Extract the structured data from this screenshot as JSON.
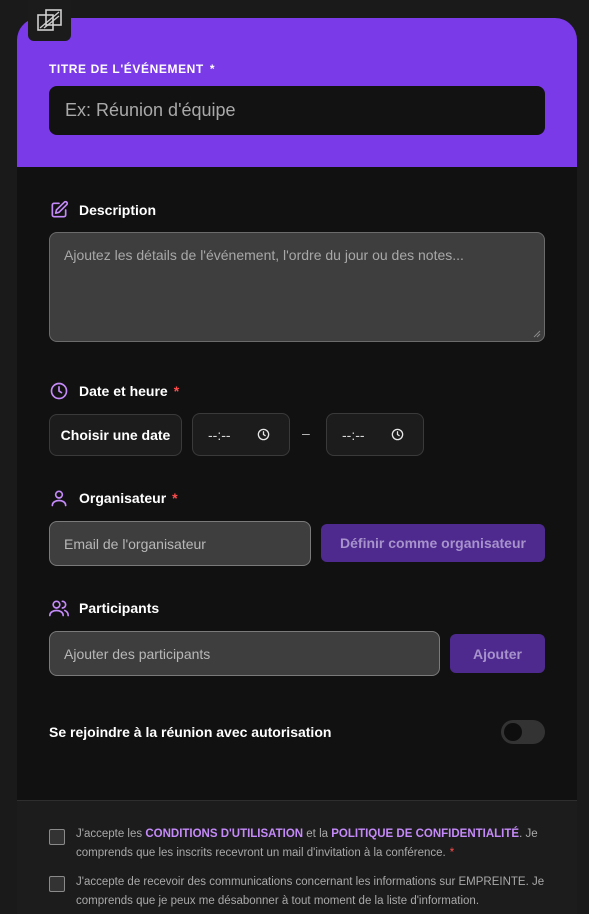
{
  "logo": {
    "icon": "squares-logo-icon"
  },
  "header": {
    "title_label": "TITRE DE L'ÉVÉNEMENT",
    "title_required": "*",
    "title_placeholder": "Ex: Réunion d'équipe",
    "color": "#7a3ae8"
  },
  "description": {
    "label": "Description",
    "icon": "edit-icon",
    "placeholder": "Ajoutez les détails de l'événement, l'ordre du jour ou des notes..."
  },
  "datetime": {
    "label": "Date et heure",
    "required": "*",
    "icon": "clock-icon",
    "date_button": "Choisir une date",
    "start_time": "--:--",
    "end_time": "--:--",
    "separator": "–"
  },
  "organizer": {
    "label": "Organisateur",
    "required": "*",
    "icon": "user-icon",
    "placeholder": "Email de l'organisateur",
    "button": "Définir comme organisateur"
  },
  "participants": {
    "label": "Participants",
    "icon": "users-icon",
    "placeholder": "Ajouter des participants",
    "button": "Ajouter"
  },
  "authorization": {
    "label": "Se rejoindre à la réunion avec autorisation",
    "enabled": false
  },
  "consents": [
    {
      "prefix": "J'accepte les ",
      "link1": "CONDITIONS D'UTILISATION",
      "middle": " et la ",
      "link2": "POLITIQUE DE CONFIDENTIALITÉ",
      "suffix": ". Je comprends que les inscrits recevront un mail d'invitation à la conférence.",
      "required": "*",
      "checked": false
    },
    {
      "text": "J'accepte de recevoir des communications concernant les informations sur EMPREINTE. Je comprends que je peux me désabonner à tout moment de la liste d'information.",
      "checked": false
    }
  ],
  "colors": {
    "accent": "#7a3ae8",
    "button": "#4e2a8f",
    "link": "#c58af9",
    "required": "#ff4d4d"
  }
}
